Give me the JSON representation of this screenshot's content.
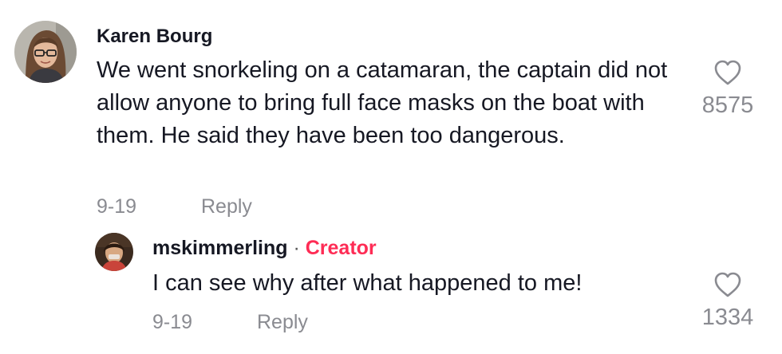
{
  "comment": {
    "username": "Karen Bourg",
    "text": "We went snorkeling on a catamaran, the captain did not allow anyone to bring full face masks on the boat with them. He said they have been too dangerous.",
    "date": "9-19",
    "reply_label": "Reply",
    "like_count": "8575",
    "like_icon": "heart-outline-icon"
  },
  "reply": {
    "username": "mskimmerling",
    "separator": " · ",
    "badge": "Creator",
    "badge_color": "#fe2c55",
    "text": "I can see why after what happened to me!",
    "date": "9-19",
    "reply_label": "Reply",
    "like_count": "1334",
    "like_icon": "heart-outline-icon"
  }
}
